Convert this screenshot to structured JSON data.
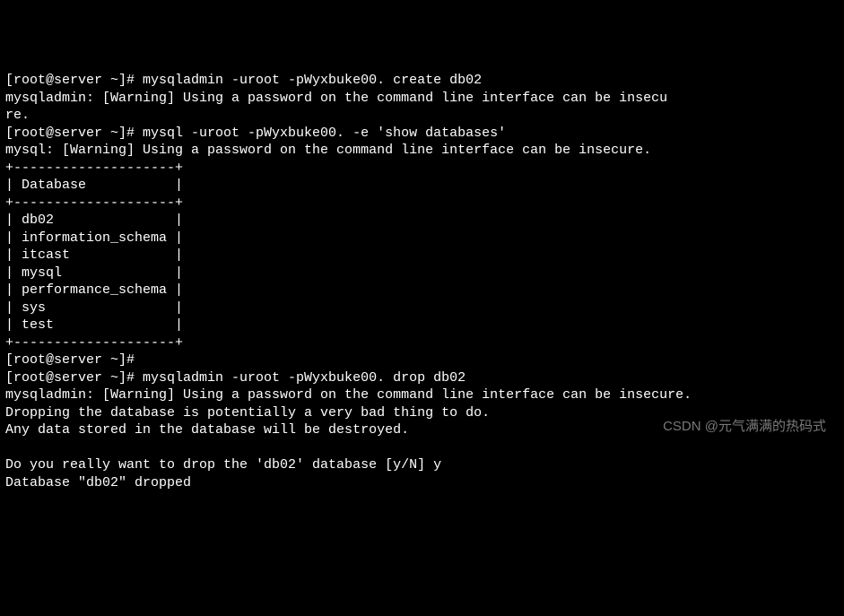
{
  "lines": [
    "[root@server ~]# mysqladmin -uroot -pWyxbuke00. create db02",
    "mysqladmin: [Warning] Using a password on the command line interface can be insecu",
    "re.",
    "[root@server ~]# mysql -uroot -pWyxbuke00. -e 'show databases'",
    "mysql: [Warning] Using a password on the command line interface can be insecure.",
    "+--------------------+",
    "| Database           |",
    "+--------------------+",
    "| db02               |",
    "| information_schema |",
    "| itcast             |",
    "| mysql              |",
    "| performance_schema |",
    "| sys                |",
    "| test               |",
    "+--------------------+",
    "[root@server ~]#",
    "[root@server ~]# mysqladmin -uroot -pWyxbuke00. drop db02",
    "mysqladmin: [Warning] Using a password on the command line interface can be insecure.",
    "Dropping the database is potentially a very bad thing to do.",
    "Any data stored in the database will be destroyed.",
    "",
    "Do you really want to drop the 'db02' database [y/N] y",
    "Database \"db02\" dropped"
  ],
  "watermark": "CSDN @元气满满的热码式"
}
